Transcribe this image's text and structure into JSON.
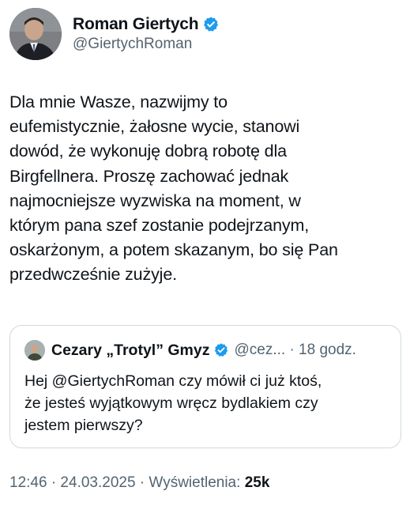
{
  "author": {
    "display_name": "Roman Giertych",
    "handle": "@GiertychRoman"
  },
  "tweet": {
    "lines": [
      "Dla mnie Wasze, nazwijmy to",
      "eufemistycznie, żałosne wycie, stanowi",
      "dowód, że wykonuję dobrą robotę dla",
      "Birgfellnera. Proszę zachować jednak",
      "najmocniejsze wyzwiska na moment, w",
      "którym pana szef zostanie podejrzanym,",
      "oskarżonym, a potem skazanym, bo się Pan",
      "przedwcześnie zużyje."
    ]
  },
  "quoted": {
    "display_name": "Cezary „Trotyl” Gmyz",
    "meta": "@cez... · 18 godz.",
    "lines": [
      "Hej @GiertychRoman czy mówił ci już ktoś,",
      "że jesteś wyjątkowym wręcz bydlakiem czy",
      "jestem pierwszy?"
    ]
  },
  "footer": {
    "timestamp": "12:46 · 24.03.2025 · ",
    "views_label": "Wyświetlenia: ",
    "views_count": "25k"
  },
  "colors": {
    "verified": "#1d9bf0",
    "secondary_text": "#536471",
    "primary_text": "#0f1419",
    "border": "#cfd9de"
  },
  "icons": {
    "verified": "verified-badge-icon"
  }
}
